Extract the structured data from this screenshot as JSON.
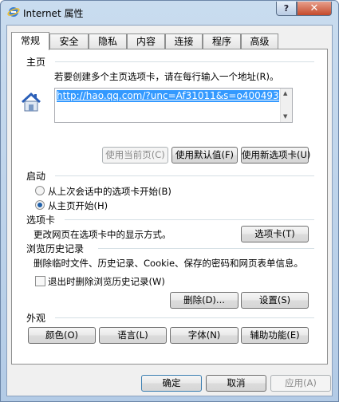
{
  "window": {
    "title": "Internet 属性",
    "help_label": "?",
    "close_label": "✕"
  },
  "tabs": [
    {
      "label": "常规"
    },
    {
      "label": "安全"
    },
    {
      "label": "隐私"
    },
    {
      "label": "内容"
    },
    {
      "label": "连接"
    },
    {
      "label": "程序"
    },
    {
      "label": "高级"
    }
  ],
  "homepage": {
    "title": "主页",
    "description": "若要创建多个主页选项卡，请在每行输入一个地址(R)。",
    "url": "http://hao.qq.com/?unc=Af31011&s=o400493",
    "use_current_label": "使用当前页(C)",
    "use_default_label": "使用默认值(F)",
    "use_new_tab_label": "使用新选项卡(U)"
  },
  "startup": {
    "title": "启动",
    "option1": "从上次会话中的选项卡开始(B)",
    "option2": "从主页开始(H)",
    "selected": "option2"
  },
  "tabs_section": {
    "title": "选项卡",
    "description": "更改网页在选项卡中的显示方式。",
    "button_label": "选项卡(T)"
  },
  "history": {
    "title": "浏览历史记录",
    "description": "删除临时文件、历史记录、Cookie、保存的密码和网页表单信息。",
    "checkbox_label": "退出时删除浏览历史记录(W)",
    "checked": false,
    "delete_label": "删除(D)...",
    "settings_label": "设置(S)"
  },
  "appearance": {
    "title": "外观",
    "colors_label": "颜色(O)",
    "languages_label": "语言(L)",
    "fonts_label": "字体(N)",
    "accessibility_label": "辅助功能(E)"
  },
  "footer": {
    "ok_label": "确定",
    "cancel_label": "取消",
    "apply_label": "应用(A)"
  }
}
